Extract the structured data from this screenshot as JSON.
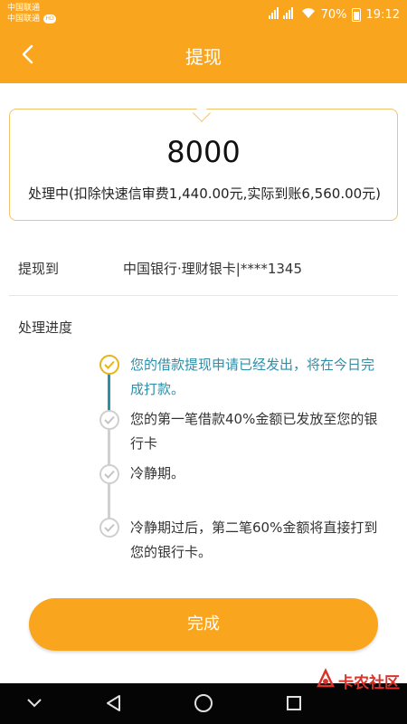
{
  "status_bar": {
    "carrier_1": "中国联通",
    "carrier_2": "中国联通",
    "carrier_badge": "HD",
    "battery": "70%",
    "time": "19:12"
  },
  "header": {
    "title": "提现"
  },
  "amount_card": {
    "amount": "8000",
    "fee_note": "处理中(扣除快速信审费1,440.00元,实际到账6,560.00元)"
  },
  "withdraw_to": {
    "label": "提现到",
    "value": "中国银行·理财银卡|****1345"
  },
  "progress": {
    "label": "处理进度",
    "steps": [
      {
        "text": "您的借款提现申请已经发出，将在今日完成打款。",
        "active": true
      },
      {
        "text": "您的第一笔借款40%金额已发放至您的银行卡",
        "active": false
      },
      {
        "text": "冷静期。",
        "active": false
      },
      {
        "text": "冷静期过后，第二笔60%金额将直接打到您的银行卡。",
        "active": false
      }
    ]
  },
  "done_button": {
    "label": "完成"
  },
  "watermark": {
    "text": "卡农社区"
  },
  "colors": {
    "brand": "#f9a51e",
    "active_step": "#2e8fa8",
    "check_active": "#e9b41b"
  }
}
